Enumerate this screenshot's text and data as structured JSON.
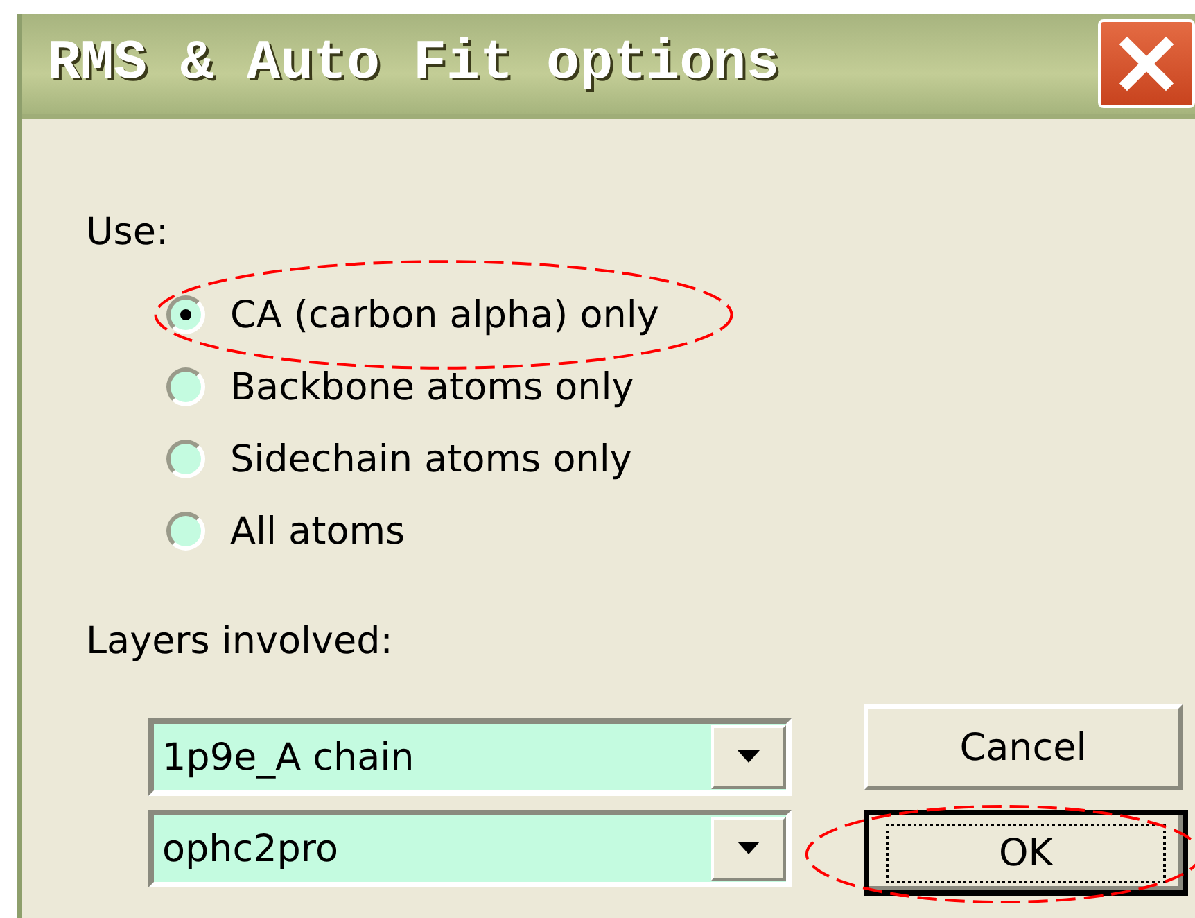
{
  "window": {
    "title": "RMS & Auto Fit options"
  },
  "use": {
    "label": "Use:",
    "options": [
      {
        "label": "CA (carbon alpha) only",
        "selected": true,
        "highlighted": true
      },
      {
        "label": "Backbone atoms only",
        "selected": false,
        "highlighted": false
      },
      {
        "label": "Sidechain atoms only",
        "selected": false,
        "highlighted": false
      },
      {
        "label": "All atoms",
        "selected": false,
        "highlighted": false
      }
    ]
  },
  "layers": {
    "label": "Layers involved:",
    "dropdowns": [
      {
        "value": "1p9e_A chain"
      },
      {
        "value": "ophc2pro"
      }
    ]
  },
  "buttons": [
    {
      "label": "Cancel",
      "default": false,
      "highlighted": false
    },
    {
      "label": "OK",
      "default": true,
      "highlighted": true
    }
  ]
}
